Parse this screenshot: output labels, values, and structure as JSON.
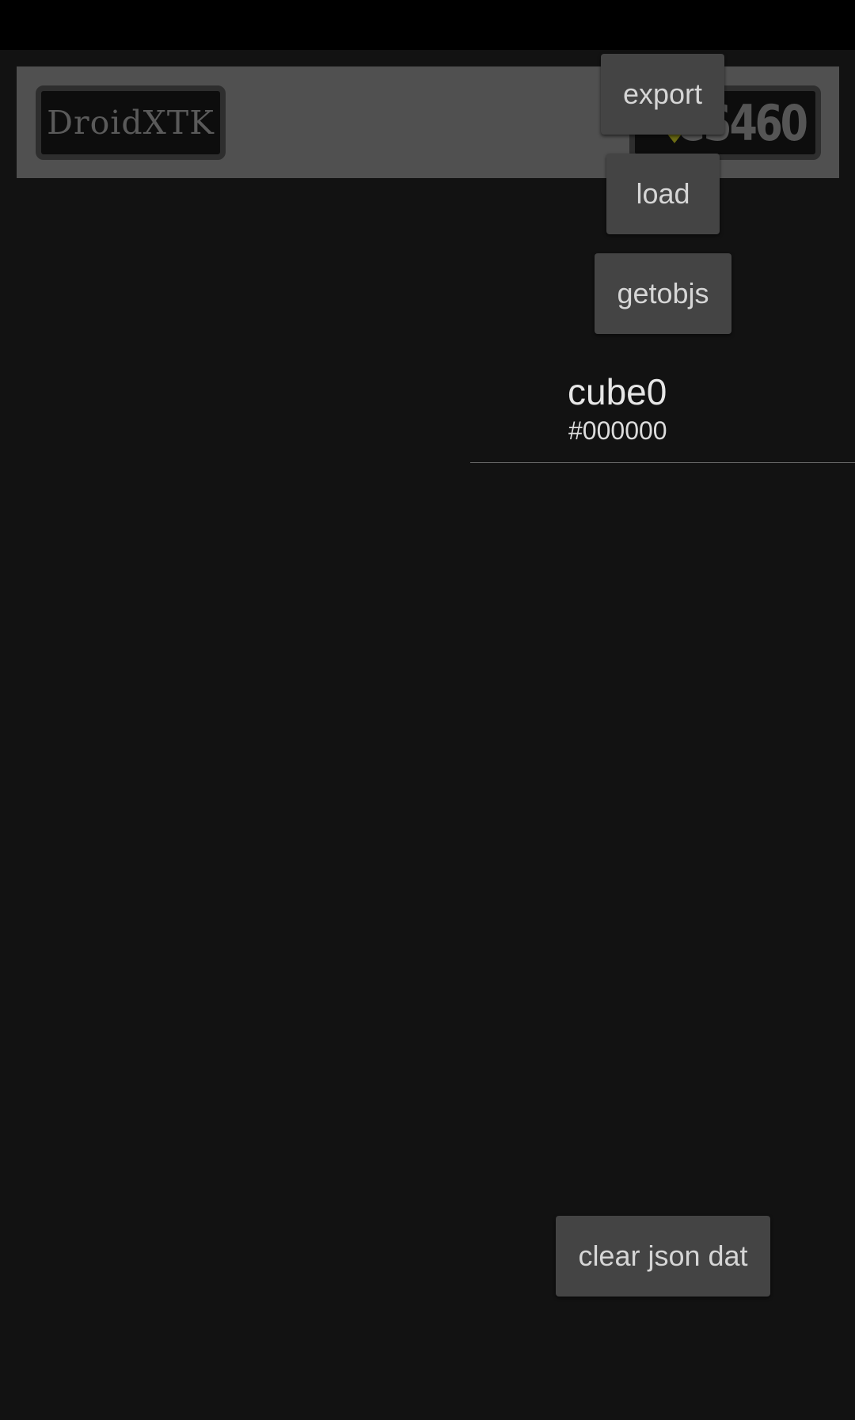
{
  "header": {
    "logo_left_text": "DroidXTK",
    "logo_right_text": "CS460"
  },
  "actions": {
    "export_label": "export",
    "load_label": "load",
    "getobjs_label": "getobjs",
    "clear_label": "clear json dat"
  },
  "objects": [
    {
      "name": "cube0",
      "color": "#000000"
    }
  ],
  "colors": {
    "background": "#121212",
    "status_bar": "#000000",
    "header_banner": "#505050",
    "button": "#444444",
    "button_text": "#d6d6d6"
  }
}
